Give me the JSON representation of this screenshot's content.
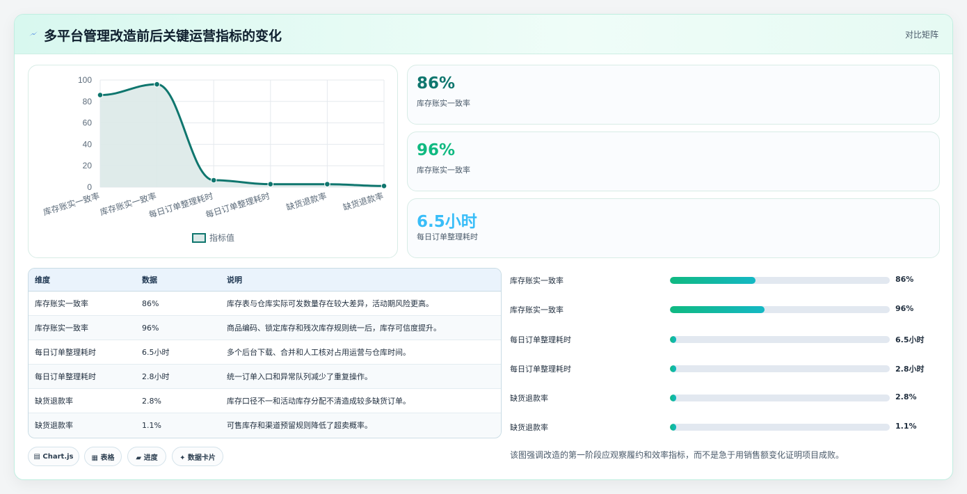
{
  "header": {
    "title": "多平台管理改造前后关键运营指标的变化",
    "tag": "对比矩阵"
  },
  "chart_data": {
    "type": "line",
    "categories": [
      "库存账实一致率",
      "库存账实一致率",
      "每日订单整理耗时",
      "每日订单整理耗时",
      "缺货退款率",
      "缺货退款率"
    ],
    "series": [
      {
        "name": "指标值",
        "values": [
          86,
          96,
          6.5,
          2.8,
          2.8,
          1.1
        ]
      }
    ],
    "ylim": [
      0,
      100
    ],
    "yticks": [
      0,
      20,
      40,
      60,
      80,
      100
    ],
    "grid": true,
    "legend": "bottom",
    "area_fill": true,
    "colors": {
      "line": "#0f766e",
      "fill": "#dbe9e8",
      "grid": "#e5e9ee",
      "tick": "#5c6b7a"
    }
  },
  "kpis": [
    {
      "value": "86%",
      "label": "库存账实一致率",
      "color": "#0f766e"
    },
    {
      "value": "96%",
      "label": "库存账实一致率",
      "color": "#10b981"
    },
    {
      "value": "6.5小时",
      "label": "每日订单整理耗时",
      "color": "#38bdf8"
    }
  ],
  "table": {
    "headers": [
      "维度",
      "数据",
      "说明"
    ],
    "rows": [
      [
        "库存账实一致率",
        "86%",
        "库存表与仓库实际可发数量存在较大差异，活动期风险更高。"
      ],
      [
        "库存账实一致率",
        "96%",
        "商品编码、锁定库存和残次库存规则统一后，库存可信度提升。"
      ],
      [
        "每日订单整理耗时",
        "6.5小时",
        "多个后台下载、合并和人工核对占用运营与仓库时间。"
      ],
      [
        "每日订单整理耗时",
        "2.8小时",
        "统一订单入口和异常队列减少了重复操作。"
      ],
      [
        "缺货退款率",
        "2.8%",
        "库存口径不一和活动库存分配不清造成较多缺货订单。"
      ],
      [
        "缺货退款率",
        "1.1%",
        "可售库存和渠道预留规则降低了超卖概率。"
      ]
    ]
  },
  "pills": [
    "▤ Chart.js",
    "▦ 表格",
    "▰ 进度",
    "✦ 数据卡片"
  ],
  "bars": [
    {
      "label": "库存账实一致率",
      "value": "86%",
      "fraction": 0.39
    },
    {
      "label": "库存账实一致率",
      "value": "96%",
      "fraction": 0.43
    },
    {
      "label": "每日订单整理耗时",
      "value": "6.5小时",
      "fraction": 0.03
    },
    {
      "label": "每日订单整理耗时",
      "value": "2.8小时",
      "fraction": 0.03
    },
    {
      "label": "缺货退款率",
      "value": "2.8%",
      "fraction": 0.03
    },
    {
      "label": "缺货退款率",
      "value": "1.1%",
      "fraction": 0.03
    }
  ],
  "note": "该图强调改造的第一阶段应观察履约和效率指标，而不是急于用销售额变化证明项目成败。"
}
